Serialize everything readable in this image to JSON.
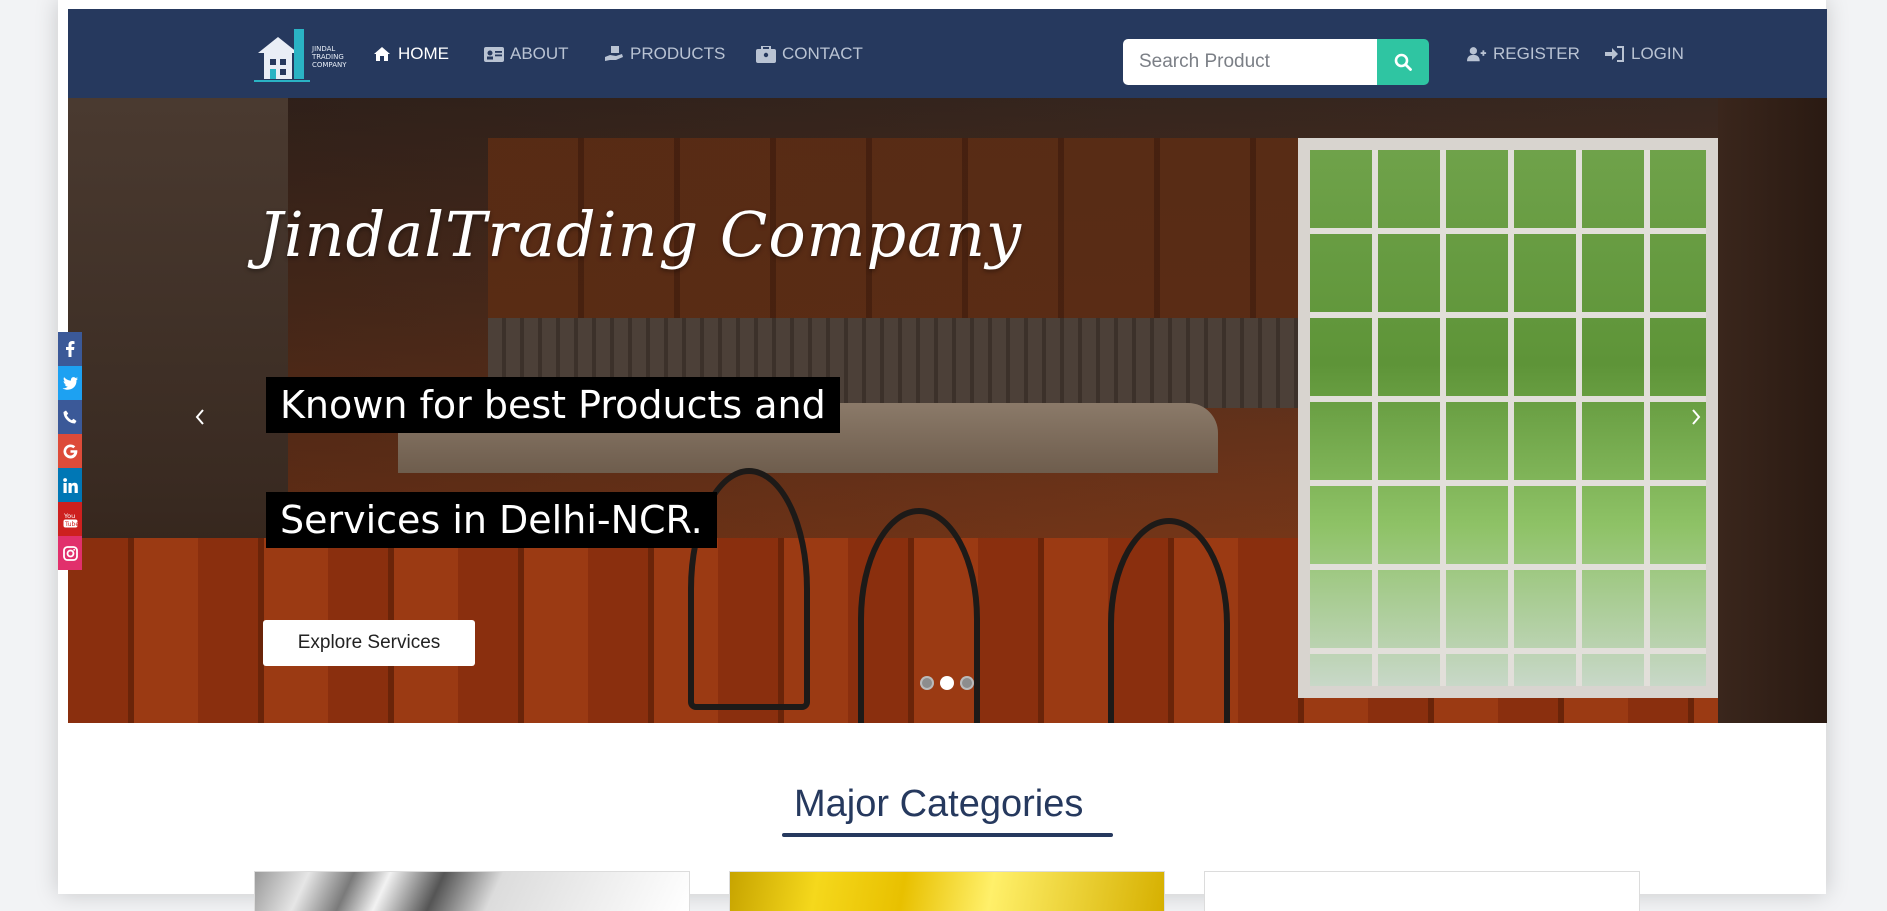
{
  "brand": {
    "logo_text_1": "JINDAL",
    "logo_text_2": "TRADING",
    "logo_text_3": "COMPANY",
    "accent": "#2fc5a2",
    "nav_bg": "#26395e"
  },
  "nav": {
    "items": [
      {
        "label": "HOME",
        "icon": "home-icon",
        "active": true
      },
      {
        "label": "ABOUT",
        "icon": "id-card-icon",
        "active": false
      },
      {
        "label": "PRODUCTS",
        "icon": "hand-box-icon",
        "active": false
      },
      {
        "label": "CONTACT",
        "icon": "briefcase-icon",
        "active": false
      }
    ],
    "register": "REGISTER",
    "login": "LOGIN"
  },
  "search": {
    "placeholder": "Search Product",
    "value": ""
  },
  "hero": {
    "title": "JindalTrading Company",
    "line1": "Known for best Products and",
    "line2": "Services in Delhi-NCR.",
    "button": "Explore Services",
    "slides_total": 3,
    "active_slide": 2
  },
  "social": [
    "facebook-icon",
    "twitter-icon",
    "phone-icon",
    "google-icon",
    "linkedin-icon",
    "youtube-icon",
    "instagram-icon"
  ],
  "social_colors": [
    "#3b5998",
    "#1da1f2",
    "#3b5998",
    "#dd4b39",
    "#0077b5",
    "#cd201f",
    "#e1306c"
  ],
  "categories": {
    "title": "Major Categories"
  }
}
